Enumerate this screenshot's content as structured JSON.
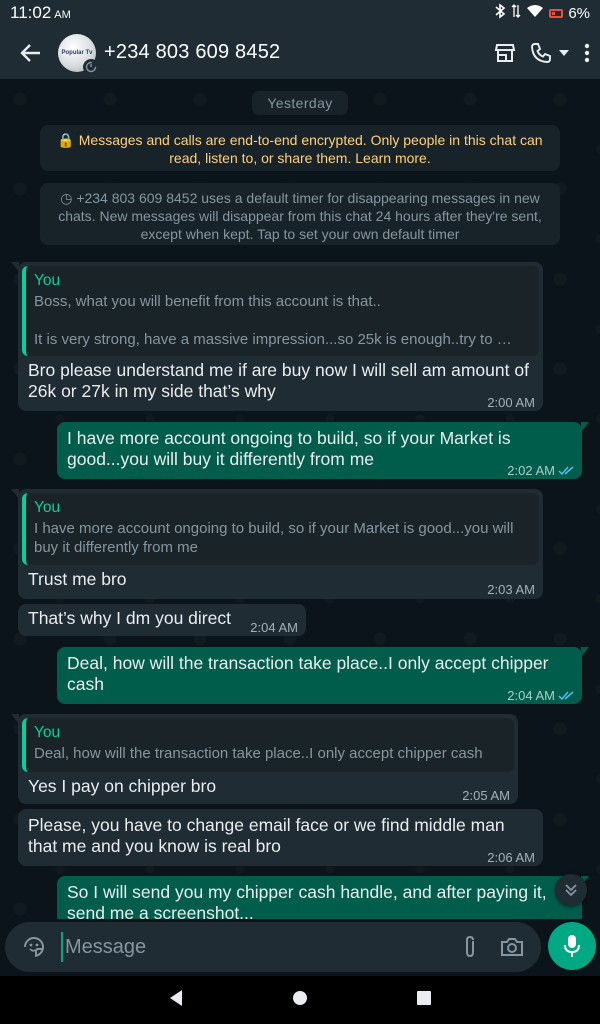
{
  "status_bar": {
    "time": "11:02",
    "ampm": "AM",
    "battery": "6%"
  },
  "header": {
    "contact": "+234 803 609 8452",
    "avatar_text": "Popular Tv"
  },
  "chat": {
    "date_label": "Yesterday",
    "encryption_notice": "🔒 Messages and calls are end-to-end encrypted. Only people in this chat can read, listen to, or share them. Learn more.",
    "timer_notice": "+234 803 609 8452 uses a default timer for disappearing messages in new chats. New messages will disappear from this chat 24 hours after they're sent, except when kept. Tap to set your own default timer",
    "messages": [
      {
        "dir": "in",
        "quote_author": "You",
        "quote_line1": "Boss, what you will benefit from this account is that..",
        "quote_line2": "It is very strong, have a massive impression...so 25k is enough..try to …",
        "text": "Bro please understand me if are buy now I will sell am amount of 26k or 27k in my side that’s why",
        "time": "2:00 AM"
      },
      {
        "dir": "out",
        "text": "I have more account ongoing to build, so if your Market is good...you will buy it differently from me",
        "time": "2:02 AM"
      },
      {
        "dir": "in",
        "quote_author": "You",
        "quote_text": "I have more account ongoing to build, so if your Market is good...you will buy it differently from me",
        "text": "Trust me bro",
        "time": "2:03 AM"
      },
      {
        "dir": "in",
        "text": "That’s why I dm you direct",
        "time": "2:04 AM"
      },
      {
        "dir": "out",
        "text": "Deal, how will the transaction take place..I only accept chipper cash",
        "time": "2:04 AM"
      },
      {
        "dir": "in",
        "quote_author": "You",
        "quote_text": "Deal, how will the transaction take place..I only accept chipper cash",
        "text": "Yes I pay on chipper bro",
        "time": "2:05 AM"
      },
      {
        "dir": "in",
        "text": "Please, you have to change email face or we find middle man that me and you know is real bro",
        "time": "2:06 AM"
      },
      {
        "dir": "out",
        "text": "So I will send you my chipper cash handle, and after paying it, send me a screenshot..."
      }
    ]
  },
  "composer": {
    "placeholder": "Message"
  },
  "colors": {
    "background": "#0b141a",
    "bar": "#1f2c34",
    "incoming": "#202c33",
    "outgoing": "#005c4b",
    "accent": "#00a884",
    "read_ticks": "#53bdeb"
  }
}
